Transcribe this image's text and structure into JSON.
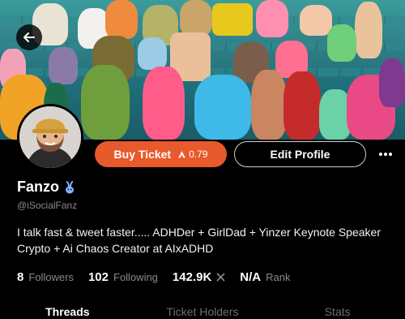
{
  "profile": {
    "name": "Fanzo",
    "handle": "@iSocialFanz",
    "bio_line1": "I talk fast & tweet faster..... ADHDer + GirlDad + Yinzer Keynote Speaker",
    "bio_line2": "Crypto + Ai Chaos Creator at AIxADHD",
    "name_badge_icon": "bunny-icon"
  },
  "actions": {
    "buy_label": "Buy Ticket",
    "buy_price": "0.79",
    "edit_label": "Edit Profile",
    "more_icon": "more-dots-icon"
  },
  "stats": {
    "followers_value": "8",
    "followers_label": "Followers",
    "following_value": "102",
    "following_label": "Following",
    "x_value": "142.9K",
    "rank_value": "N/A",
    "rank_label": "Rank"
  },
  "tabs": [
    "Threads",
    "Ticket Holders",
    "Stats"
  ],
  "colors": {
    "accent": "#e8592c",
    "background": "#000000",
    "muted_text": "#8a8a8a",
    "badge": "#7fb2ff"
  }
}
